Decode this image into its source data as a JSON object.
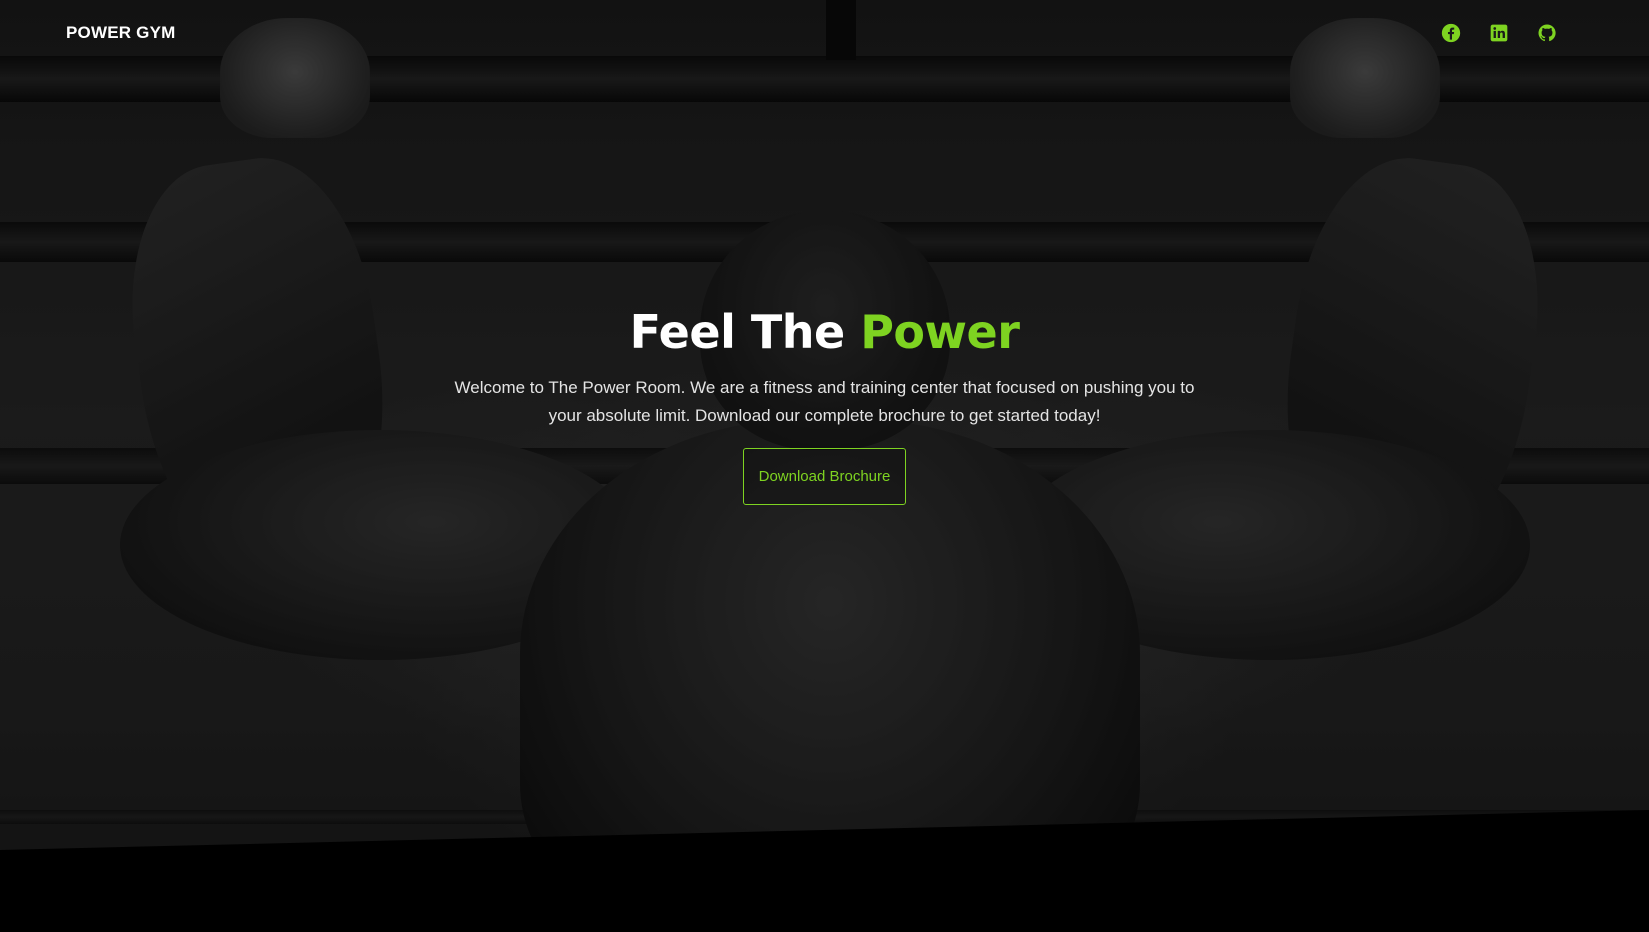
{
  "navbar": {
    "brand": "POWER GYM",
    "social_links": [
      {
        "icon": "facebook-icon"
      },
      {
        "icon": "linkedin-icon"
      },
      {
        "icon": "github-icon"
      }
    ]
  },
  "hero": {
    "title_prefix": "Feel The ",
    "title_accent": "Power",
    "description": "Welcome to The Power Room. We are a fitness and training center that focused on pushing you to your absolute limit. Download our complete brochure to get started today!",
    "cta_label": "Download Brochure"
  },
  "colors": {
    "accent": "#7ed321",
    "background": "#000000",
    "text": "#ffffff"
  }
}
